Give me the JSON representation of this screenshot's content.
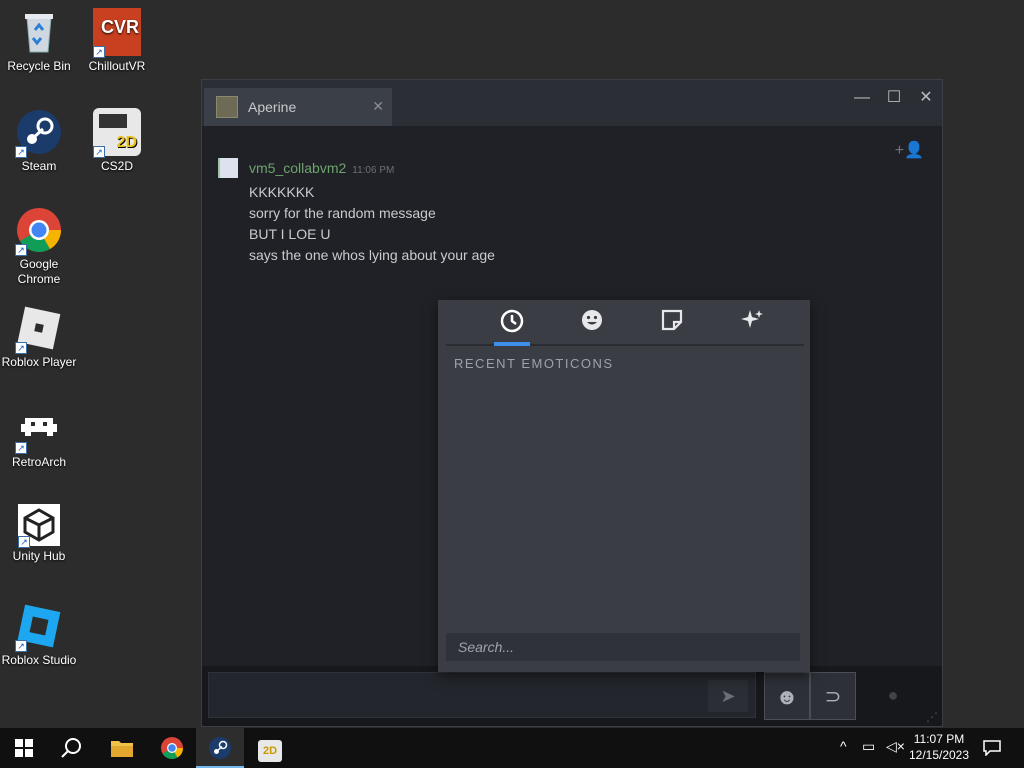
{
  "desktop": {
    "icons": [
      {
        "label": "Recycle Bin",
        "icon": "recycle-bin-icon"
      },
      {
        "label": "ChilloutVR",
        "icon": "chilloutvr-icon"
      },
      {
        "label": "Steam",
        "icon": "steam-icon"
      },
      {
        "label": "CS2D",
        "icon": "cs2d-icon"
      },
      {
        "label": "Google Chrome",
        "icon": "chrome-icon"
      },
      {
        "label": "Roblox Player",
        "icon": "roblox-player-icon"
      },
      {
        "label": "RetroArch",
        "icon": "retroarch-icon"
      },
      {
        "label": "Unity Hub",
        "icon": "unity-hub-icon"
      },
      {
        "label": "Roblox Studio",
        "icon": "roblox-studio-icon"
      }
    ]
  },
  "chat": {
    "tab_name": "Aperine",
    "controls": {
      "minimize": "—",
      "maximize": "☐",
      "close": "✕"
    },
    "message": {
      "sender": "vm5_collabvm2",
      "time": "11:06 PM",
      "lines": [
        "KKKKKKK",
        "sorry for the random message",
        "BUT I LOE U",
        "says the one whos lying about your age"
      ]
    }
  },
  "emoticon_picker": {
    "tabs": [
      {
        "icon": "clock-icon",
        "glyph": "🕓"
      },
      {
        "icon": "smiley-icon",
        "glyph": "☻"
      },
      {
        "icon": "sticker-icon",
        "glyph": "▣"
      },
      {
        "icon": "sparkle-icon",
        "glyph": "✦"
      }
    ],
    "section_title": "RECENT EMOTICONS",
    "search_placeholder": "Search..."
  },
  "taskbar": {
    "time": "11:07 PM",
    "date": "12/15/2023"
  },
  "colors": {
    "accent": "#3d8ee8",
    "sender_name": "#6ea36e"
  }
}
